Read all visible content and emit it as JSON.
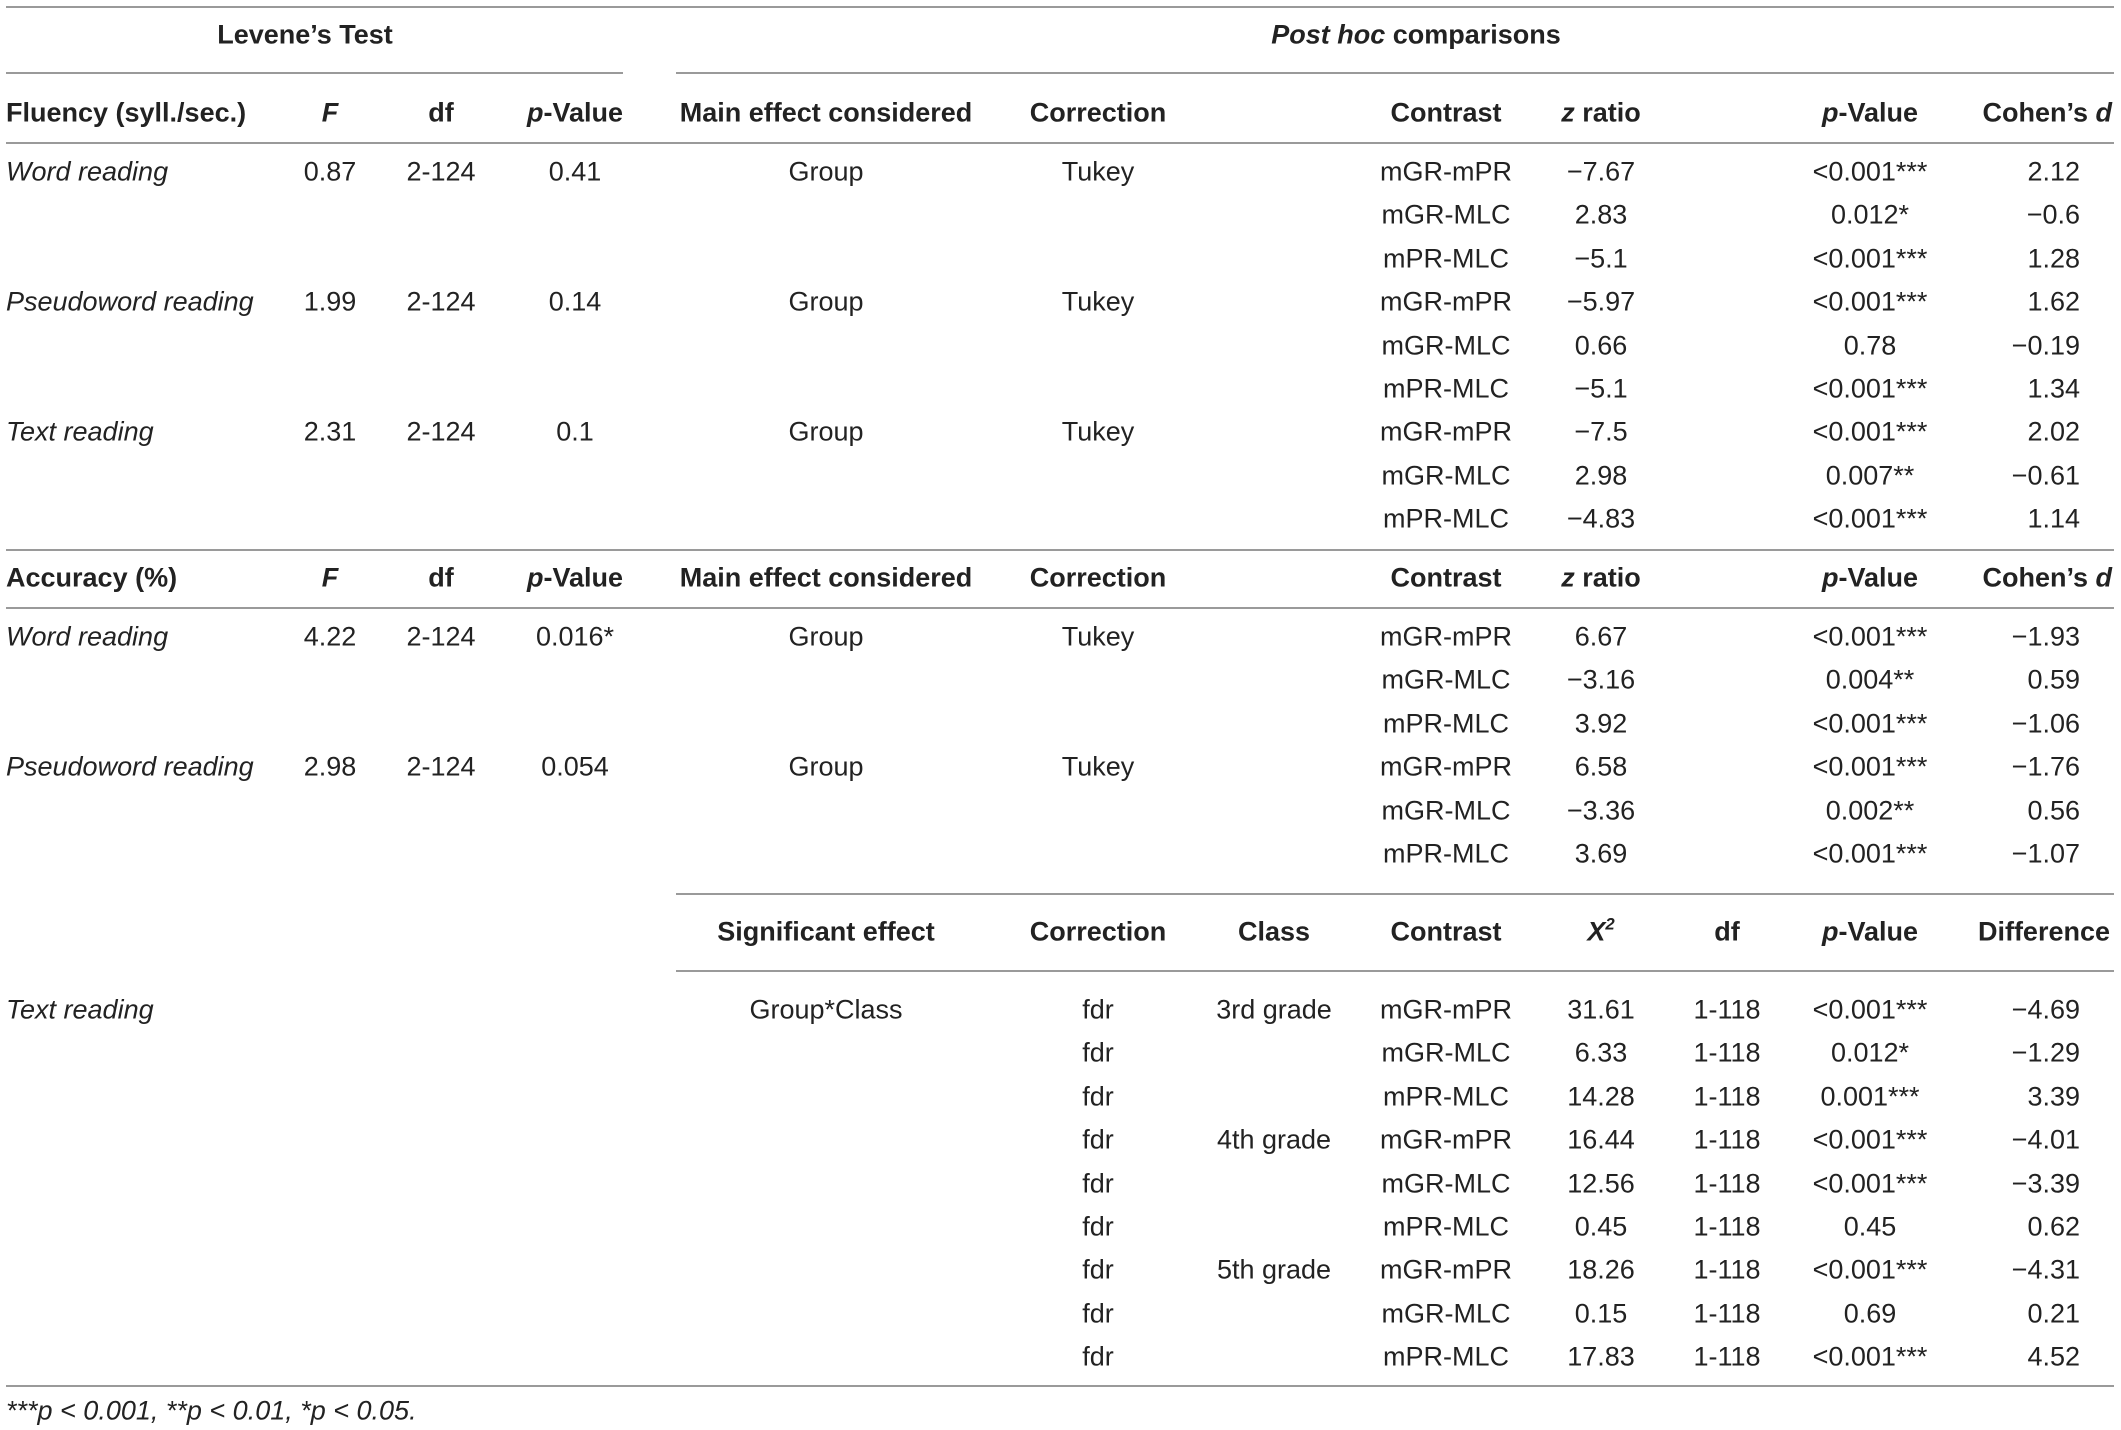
{
  "header": {
    "levene_title": "Levene’s Test",
    "posthoc_title_italic": "Post hoc",
    "posthoc_title_rest": " comparisons"
  },
  "fluency_header": {
    "measure": "Fluency (syll./sec.)",
    "F": "F",
    "df": "df",
    "p_italic": "p",
    "p_rest": "-Value",
    "main_effect": "Main effect considered",
    "correction": "Correction",
    "contrast": "Contrast",
    "z_italic": "z",
    "z_rest": " ratio",
    "p2_italic": "p",
    "p2_rest": "-Value",
    "d_rest": "Cohen’s ",
    "d_italic": "d"
  },
  "fluency_rows": [
    {
      "measure": "Word reading",
      "F": "0.87",
      "df": "2-124",
      "p": "0.41",
      "effect": "Group",
      "correction": "Tukey",
      "contrast": "mGR-mPR",
      "z": "−7.67",
      "p2": "<0.001***",
      "d": "2.12"
    },
    {
      "measure": "",
      "F": "",
      "df": "",
      "p": "",
      "effect": "",
      "correction": "",
      "contrast": "mGR-MLC",
      "z": "2.83",
      "p2": "0.012*",
      "d": "−0.6"
    },
    {
      "measure": "",
      "F": "",
      "df": "",
      "p": "",
      "effect": "",
      "correction": "",
      "contrast": "mPR-MLC",
      "z": "−5.1",
      "p2": "<0.001***",
      "d": "1.28"
    },
    {
      "measure": "Pseudoword reading",
      "F": "1.99",
      "df": "2-124",
      "p": "0.14",
      "effect": "Group",
      "correction": "Tukey",
      "contrast": "mGR-mPR",
      "z": "−5.97",
      "p2": "<0.001***",
      "d": "1.62"
    },
    {
      "measure": "",
      "F": "",
      "df": "",
      "p": "",
      "effect": "",
      "correction": "",
      "contrast": "mGR-MLC",
      "z": "0.66",
      "p2": "0.78",
      "d": "−0.19"
    },
    {
      "measure": "",
      "F": "",
      "df": "",
      "p": "",
      "effect": "",
      "correction": "",
      "contrast": "mPR-MLC",
      "z": "−5.1",
      "p2": "<0.001***",
      "d": "1.34"
    },
    {
      "measure": "Text reading",
      "F": "2.31",
      "df": "2-124",
      "p": "0.1",
      "effect": "Group",
      "correction": "Tukey",
      "contrast": "mGR-mPR",
      "z": "−7.5",
      "p2": "<0.001***",
      "d": "2.02"
    },
    {
      "measure": "",
      "F": "",
      "df": "",
      "p": "",
      "effect": "",
      "correction": "",
      "contrast": "mGR-MLC",
      "z": "2.98",
      "p2": "0.007**",
      "d": "−0.61"
    },
    {
      "measure": "",
      "F": "",
      "df": "",
      "p": "",
      "effect": "",
      "correction": "",
      "contrast": "mPR-MLC",
      "z": "−4.83",
      "p2": "<0.001***",
      "d": "1.14"
    }
  ],
  "accuracy_header": {
    "measure": "Accuracy (%)",
    "F": "F",
    "df": "df",
    "p_italic": "p",
    "p_rest": "-Value",
    "main_effect": "Main effect considered",
    "correction": "Correction",
    "contrast": "Contrast",
    "z_italic": "z",
    "z_rest": " ratio",
    "p2_italic": "p",
    "p2_rest": "-Value",
    "d_rest": "Cohen’s ",
    "d_italic": "d"
  },
  "accuracy_rows": [
    {
      "measure": "Word reading",
      "F": "4.22",
      "df": "2-124",
      "p": "0.016*",
      "effect": "Group",
      "correction": "Tukey",
      "contrast": "mGR-mPR",
      "z": "6.67",
      "p2": "<0.001***",
      "d": "−1.93"
    },
    {
      "measure": "",
      "F": "",
      "df": "",
      "p": "",
      "effect": "",
      "correction": "",
      "contrast": "mGR-MLC",
      "z": "−3.16",
      "p2": "0.004**",
      "d": "0.59"
    },
    {
      "measure": "",
      "F": "",
      "df": "",
      "p": "",
      "effect": "",
      "correction": "",
      "contrast": "mPR-MLC",
      "z": "3.92",
      "p2": "<0.001***",
      "d": "−1.06"
    },
    {
      "measure": "Pseudoword reading",
      "F": "2.98",
      "df": "2-124",
      "p": "0.054",
      "effect": "Group",
      "correction": "Tukey",
      "contrast": "mGR-mPR",
      "z": "6.58",
      "p2": "<0.001***",
      "d": "−1.76"
    },
    {
      "measure": "",
      "F": "",
      "df": "",
      "p": "",
      "effect": "",
      "correction": "",
      "contrast": "mGR-MLC",
      "z": "−3.36",
      "p2": "0.002**",
      "d": "0.56"
    },
    {
      "measure": "",
      "F": "",
      "df": "",
      "p": "",
      "effect": "",
      "correction": "",
      "contrast": "mPR-MLC",
      "z": "3.69",
      "p2": "<0.001***",
      "d": "−1.07"
    }
  ],
  "interaction_header": {
    "effect": "Significant effect",
    "correction": "Correction",
    "class": "Class",
    "contrast": "Contrast",
    "chi_base": "X",
    "chi_sup": "2",
    "df": "df",
    "p_italic": "p",
    "p_rest": "-Value",
    "difference": "Difference"
  },
  "interaction_rows": [
    {
      "measure": "Text reading",
      "effect": "Group*Class",
      "correction": "fdr",
      "class": "3rd grade",
      "contrast": "mGR-mPR",
      "chi": "31.61",
      "df": "1-118",
      "p": "<0.001***",
      "diff": "−4.69"
    },
    {
      "measure": "",
      "effect": "",
      "correction": "fdr",
      "class": "",
      "contrast": "mGR-MLC",
      "chi": "6.33",
      "df": "1-118",
      "p": "0.012*",
      "diff": "−1.29"
    },
    {
      "measure": "",
      "effect": "",
      "correction": "fdr",
      "class": "",
      "contrast": "mPR-MLC",
      "chi": "14.28",
      "df": "1-118",
      "p": "0.001***",
      "diff": "3.39"
    },
    {
      "measure": "",
      "effect": "",
      "correction": "fdr",
      "class": "4th grade",
      "contrast": "mGR-mPR",
      "chi": "16.44",
      "df": "1-118",
      "p": "<0.001***",
      "diff": "−4.01"
    },
    {
      "measure": "",
      "effect": "",
      "correction": "fdr",
      "class": "",
      "contrast": "mGR-MLC",
      "chi": "12.56",
      "df": "1-118",
      "p": "<0.001***",
      "diff": "−3.39"
    },
    {
      "measure": "",
      "effect": "",
      "correction": "fdr",
      "class": "",
      "contrast": "mPR-MLC",
      "chi": "0.45",
      "df": "1-118",
      "p": "0.45",
      "diff": "0.62"
    },
    {
      "measure": "",
      "effect": "",
      "correction": "fdr",
      "class": "5th grade",
      "contrast": "mGR-mPR",
      "chi": "18.26",
      "df": "1-118",
      "p": "<0.001***",
      "diff": "−4.31"
    },
    {
      "measure": "",
      "effect": "",
      "correction": "fdr",
      "class": "",
      "contrast": "mGR-MLC",
      "chi": "0.15",
      "df": "1-118",
      "p": "0.69",
      "diff": "0.21"
    },
    {
      "measure": "",
      "effect": "",
      "correction": "fdr",
      "class": "",
      "contrast": "mPR-MLC",
      "chi": "17.83",
      "df": "1-118",
      "p": "<0.001***",
      "diff": "4.52"
    }
  ],
  "footnote": "***p < 0.001, **p < 0.01, *p < 0.05."
}
